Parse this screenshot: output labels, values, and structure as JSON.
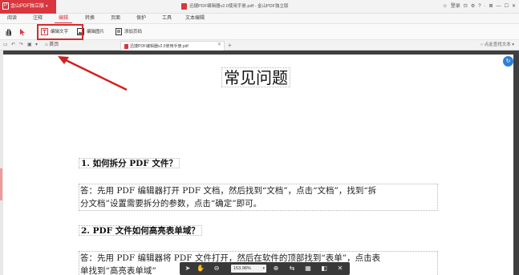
{
  "app": {
    "badge": "金山PDF独立版",
    "title": "迅捷PDF编辑器v2.0使用手册.pdf - 金山PDF独立版",
    "login": "登录"
  },
  "menu": [
    "阅读",
    "注释",
    "编辑",
    "转换",
    "页面",
    "保护",
    "工具",
    "文本编辑"
  ],
  "menu_active": "编辑",
  "ribbon": {
    "edit_text": "编辑文字",
    "edit_image": "编辑图片",
    "add_page": "添加页码"
  },
  "tabs": {
    "home": "首页",
    "document": "迅捷PDF编辑器v2.0使用手册.pdf"
  },
  "find": {
    "placeholder": "点此查找文本"
  },
  "document": {
    "heading": "常见问题",
    "q1_title": "1. 如何拆分 PDF 文件？",
    "a1_line1": "答：先用 PDF 编辑器打开 PDF 文档，然后找到“文档”，点击“文档”，找到“拆",
    "a1_line2": "分文档”设置需要拆分的参数，点击“确定”即可。",
    "q2_title": "2. PDF 文件如何高亮表单域？",
    "a2_line1": "答：先用 PDF 编辑器将 PDF 文件打开，然后在软件的顶部找到“表单”，点击表",
    "a2_line2": "单找到“高亮表单域”"
  },
  "viewer": {
    "zoom": "153.98%"
  },
  "colors": {
    "accent": "#d9363e",
    "highlight": "#d62b2b",
    "arrow": "#d21f1f",
    "badge_blue": "#2d7fd8"
  },
  "icons": [
    "hand-icon",
    "cursor-icon",
    "edit-text-icon",
    "edit-image-icon",
    "add-page-icon",
    "home-icon",
    "plus-icon",
    "search-icon",
    "zoom-out-icon",
    "zoom-in-icon",
    "fit-page-icon",
    "single-page-icon",
    "close-icon"
  ]
}
